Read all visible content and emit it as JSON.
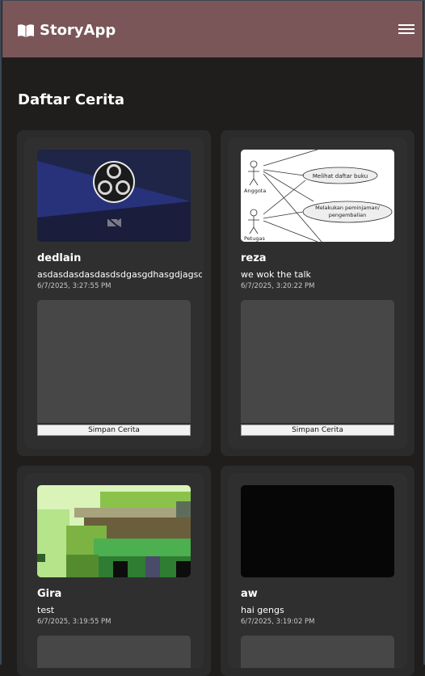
{
  "app": {
    "title": "StoryApp"
  },
  "header": {
    "menu_icon": "hamburger-icon",
    "brand_icon": "book-icon"
  },
  "page": {
    "title": "Daftar Cerita"
  },
  "stories": [
    {
      "name": "dedlain",
      "description": "asdasdasdasdasdsdgasgdhasgdjagsd",
      "date": "6/7/2025, 3:27:55 PM",
      "save_label": "Simpan Cerita",
      "image": "obs-logo"
    },
    {
      "name": "reza",
      "description": "we wok the talk",
      "date": "6/7/2025, 3:20:22 PM",
      "save_label": "Simpan Cerita",
      "image": "use-case-diagram"
    },
    {
      "name": "Gira",
      "description": "test",
      "date": "6/7/2025, 3:19:55 PM",
      "image": "pixel-art"
    },
    {
      "name": "aw",
      "description": "hai gengs",
      "date": "6/7/2025, 3:19:02 PM",
      "image": "black"
    }
  ],
  "diagram": {
    "actor1": "Anggota",
    "actor2": "Petugas",
    "usecase1": "Melihat daftar buku",
    "usecase2a": "Melakukan peminjaman/",
    "usecase2b": "pengembalian"
  },
  "colors": {
    "header": "#7a5658",
    "background": "#1f1e1d",
    "card": "#2b2b2b",
    "map": "#474747"
  }
}
